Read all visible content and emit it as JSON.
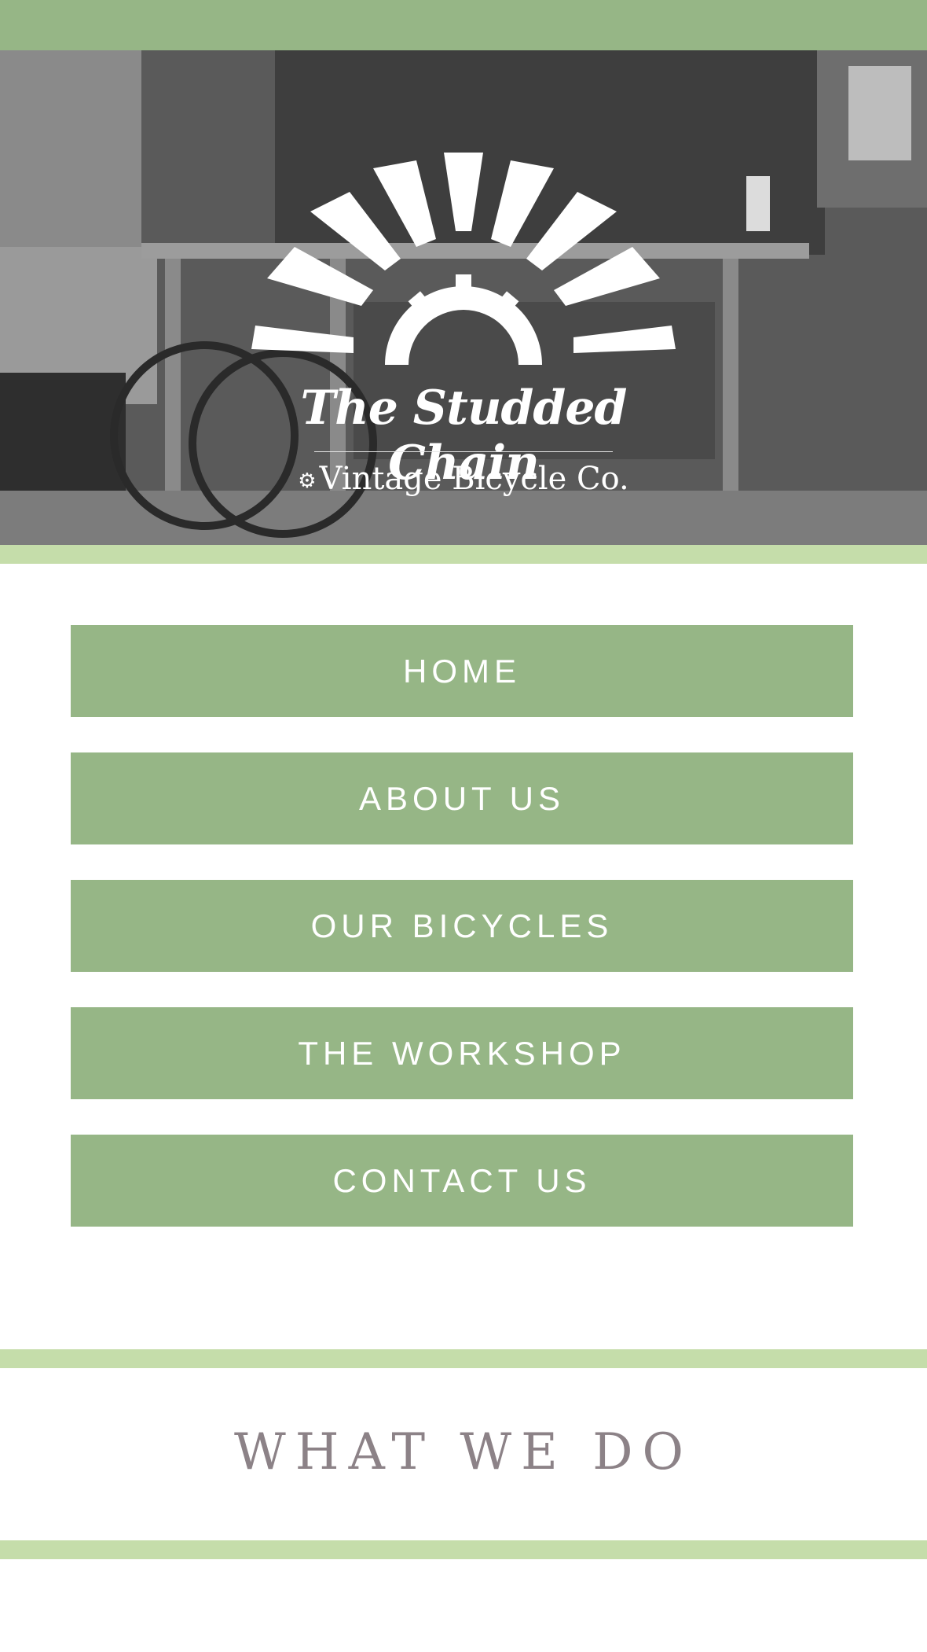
{
  "brand": {
    "name": "The Studded Chain",
    "tagline": "Vintage Bicycle Co."
  },
  "nav": {
    "items": [
      {
        "label": "HOME"
      },
      {
        "label": "ABOUT US"
      },
      {
        "label": "OUR BICYCLES"
      },
      {
        "label": "THE WORKSHOP"
      },
      {
        "label": "CONTACT US"
      }
    ]
  },
  "sections": {
    "what_we_do": {
      "title": "WHAT WE DO"
    }
  },
  "colors": {
    "accent_green": "#96b686",
    "light_green": "#c5ddaa",
    "heading_gray": "#8c8287"
  }
}
